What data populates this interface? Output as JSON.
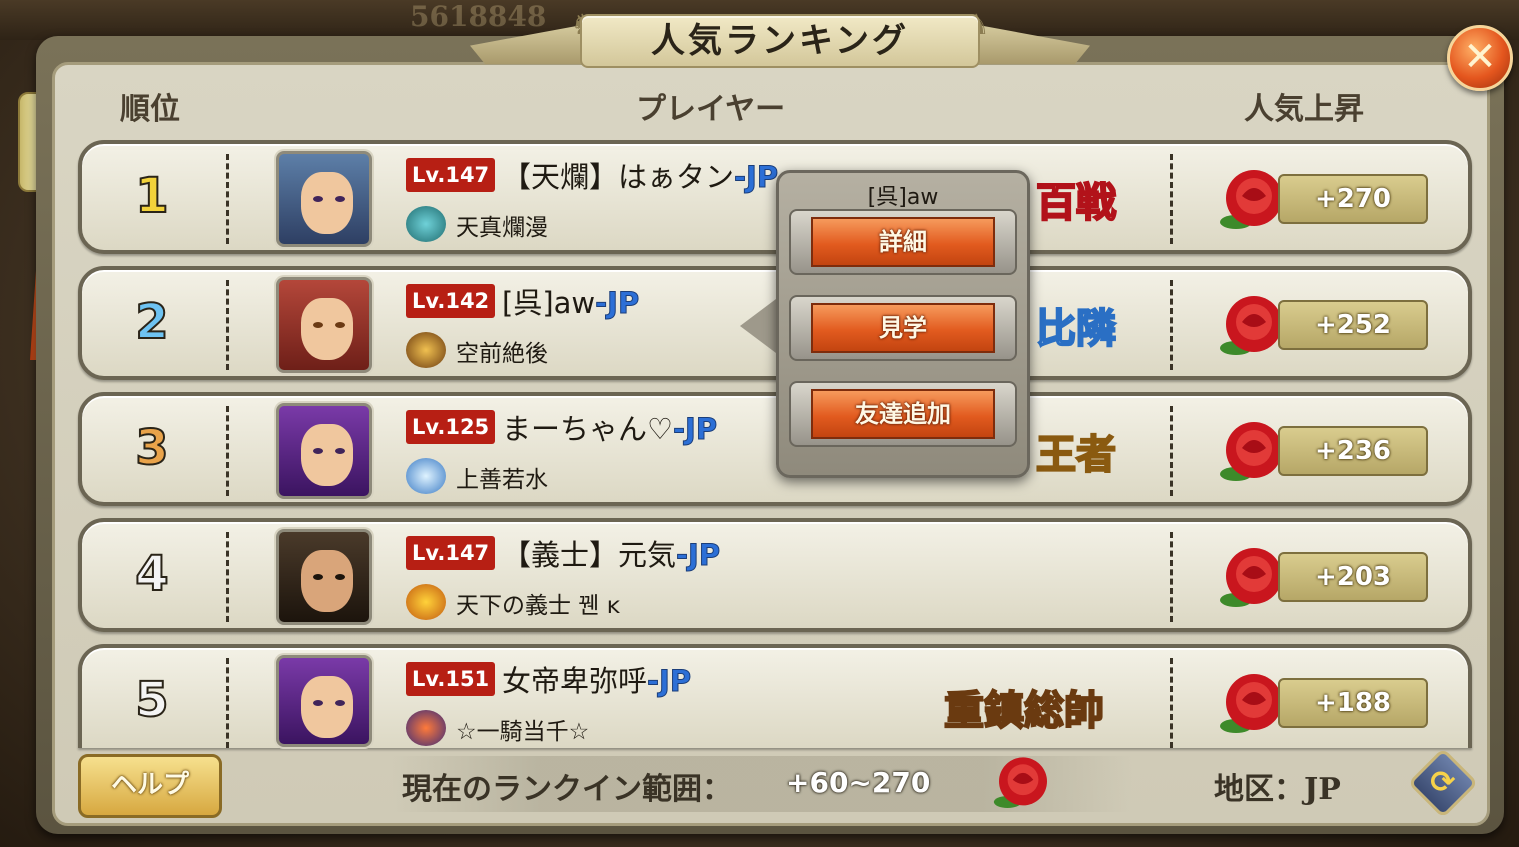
{
  "title": "人気ランキング",
  "headers": {
    "rank": "順位",
    "player": "プレイヤー",
    "popularity": "人気上昇"
  },
  "rows": [
    {
      "rank": "1",
      "level": "Lv.147",
      "name": "【天爛】はぁタン",
      "suffix": "-JP",
      "guild": "天真爛漫",
      "badge": "百戦",
      "popularity": "+270",
      "rank_color": "#f2d23a"
    },
    {
      "rank": "2",
      "level": "Lv.142",
      "name": "[呉]aw",
      "suffix": "-JP",
      "guild": "空前絶後",
      "badge": "比隣",
      "popularity": "+252",
      "rank_color": "#6ec3f2"
    },
    {
      "rank": "3",
      "level": "Lv.125",
      "name": "まーちゃん♡",
      "suffix": "-JP",
      "guild": "上善若水",
      "badge": "王者",
      "popularity": "+236",
      "rank_color": "#e9a34a"
    },
    {
      "rank": "4",
      "level": "Lv.147",
      "name": "【義士】元気",
      "suffix": "-JP",
      "guild": "天下の義士 꿴 ĸ",
      "badge": "",
      "popularity": "+203",
      "rank_color": "#f4f4f4"
    },
    {
      "rank": "5",
      "level": "Lv.151",
      "name": "女帝卑弥呼",
      "suffix": "-JP",
      "guild": "☆一騎当千☆",
      "badge": "重鎮総帥",
      "popularity": "+188",
      "rank_color": "#f4f4f4"
    }
  ],
  "popup": {
    "title": "[呉]aw",
    "buttons": [
      "詳細",
      "見学",
      "友達追加"
    ]
  },
  "footer": {
    "help_label": "ヘルプ",
    "range_label": "現在のランクイン範囲：",
    "range_value": "+60~270",
    "region": "地区：JP"
  },
  "background": {
    "counter": "5618848"
  },
  "icons": {
    "close": "close-x-icon",
    "rose": "rose-icon",
    "refresh": "refresh-icon"
  },
  "colors": {
    "level_badge": "#b71f14",
    "jp_suffix": "#2c6fd6",
    "popup_button": "#e25b1f"
  }
}
